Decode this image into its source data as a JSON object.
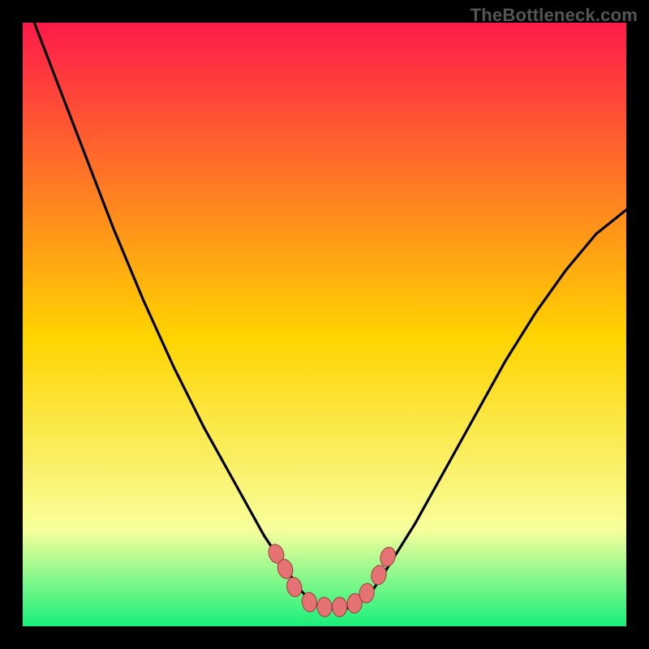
{
  "watermark": "TheBottleneck.com",
  "colors": {
    "frame": "#000000",
    "grad_top": "#ff1a4a",
    "grad_mid": "#ffd400",
    "grad_low": "#f7ff9c",
    "grad_bottom": "#18f07a",
    "curve": "#000000",
    "marker_fill": "#e57373",
    "marker_stroke": "#9c3c3c"
  },
  "chart_data": {
    "type": "line",
    "title": "",
    "xlabel": "",
    "ylabel": "",
    "xlim": [
      0,
      100
    ],
    "ylim": [
      0,
      100
    ],
    "series": [
      {
        "name": "bottleneck-curve",
        "x": [
          0,
          5,
          10,
          15,
          20,
          25,
          30,
          35,
          40,
          42,
          44,
          46,
          48,
          50,
          52,
          54,
          56,
          58,
          60,
          65,
          70,
          75,
          80,
          85,
          90,
          95,
          100
        ],
        "y": [
          105,
          92,
          79,
          66,
          54,
          43,
          33,
          24,
          15,
          12,
          9,
          6,
          4,
          3,
          3,
          3,
          4,
          6,
          9,
          17,
          26,
          35,
          44,
          52,
          59,
          65,
          69
        ]
      }
    ],
    "markers": [
      {
        "x": 42.0,
        "y": 12.0
      },
      {
        "x": 43.5,
        "y": 9.5
      },
      {
        "x": 45.0,
        "y": 6.5
      },
      {
        "x": 47.5,
        "y": 4.0
      },
      {
        "x": 50.0,
        "y": 3.2
      },
      {
        "x": 52.5,
        "y": 3.2
      },
      {
        "x": 55.0,
        "y": 3.8
      },
      {
        "x": 57.0,
        "y": 5.5
      },
      {
        "x": 59.0,
        "y": 8.5
      },
      {
        "x": 60.5,
        "y": 11.5
      }
    ]
  }
}
